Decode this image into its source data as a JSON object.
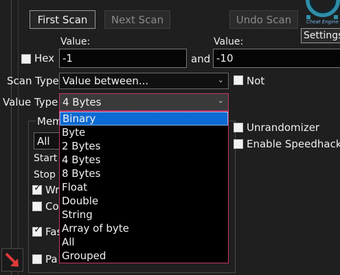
{
  "toolbar": {
    "first_scan": "First Scan",
    "next_scan": "Next Scan",
    "undo_scan": "Undo Scan",
    "settings": "Settings"
  },
  "logo": {
    "caption": "Cheat Engine"
  },
  "scan": {
    "hex_label": "Hex",
    "value_label_1": "Value:",
    "value_label_2": "Value:",
    "value1": "-1",
    "and_label": "and",
    "value2": "-10",
    "scan_type_label": "Scan Type",
    "scan_type_value": "Value between...",
    "not_label": "Not",
    "value_type_label": "Value Type",
    "value_type_value": "4 Bytes"
  },
  "dropdown": {
    "items": [
      "Binary",
      "Byte",
      "2 Bytes",
      "4 Bytes",
      "8 Bytes",
      "Float",
      "Double",
      "String",
      "Array of byte",
      "All",
      "Grouped"
    ],
    "selected": "Binary"
  },
  "memory_group": {
    "title_partial": "Mem",
    "region_partial": "All",
    "start_partial": "Start",
    "stop_partial": "Stop",
    "writable_partial": "Wr",
    "copy_on_write_partial": "Co",
    "fast_scan_partial": "Fas",
    "pause_partial": "Pa"
  },
  "options": {
    "unrandomizer": "Unrandomizer",
    "speedhack": "Enable Speedhack"
  },
  "colors": {
    "selection": "#0b6ad3",
    "list_border": "#c8356a",
    "arrow": "#e03a3a"
  }
}
